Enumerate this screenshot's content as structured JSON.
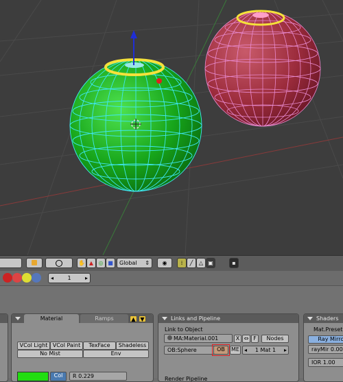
{
  "header": {
    "transform_space": "Global",
    "frame": "1"
  },
  "material_panel": {
    "tab_material": "Material",
    "tab_ramps": "Ramps",
    "buttons": [
      "VCol Light",
      "VCol Paint",
      "TexFace",
      "Shadeless"
    ],
    "buttons2": [
      "No Mist",
      "Env"
    ],
    "col_label": "Col",
    "r_value": "R 0.229",
    "color": "#22dd11"
  },
  "links_panel": {
    "title": "Links and Pipeline",
    "link_to_object": "Link to Object",
    "material_name": "MA:Material.001",
    "x_label": "X",
    "f_label": "F",
    "nodes_label": "Nodes",
    "object_name": "OB:Sphere",
    "ob_label": "OB",
    "me_label": "ME",
    "mat_index": "1 Mat 1",
    "render_pipeline": "Render Pipeline"
  },
  "shaders_panel": {
    "title": "Shaders",
    "mat_preset": "Mat.Preset",
    "ray_mirror": "Ray Mirror",
    "raymir": "rayMir 0.00",
    "ior": "IOR 1.00"
  }
}
